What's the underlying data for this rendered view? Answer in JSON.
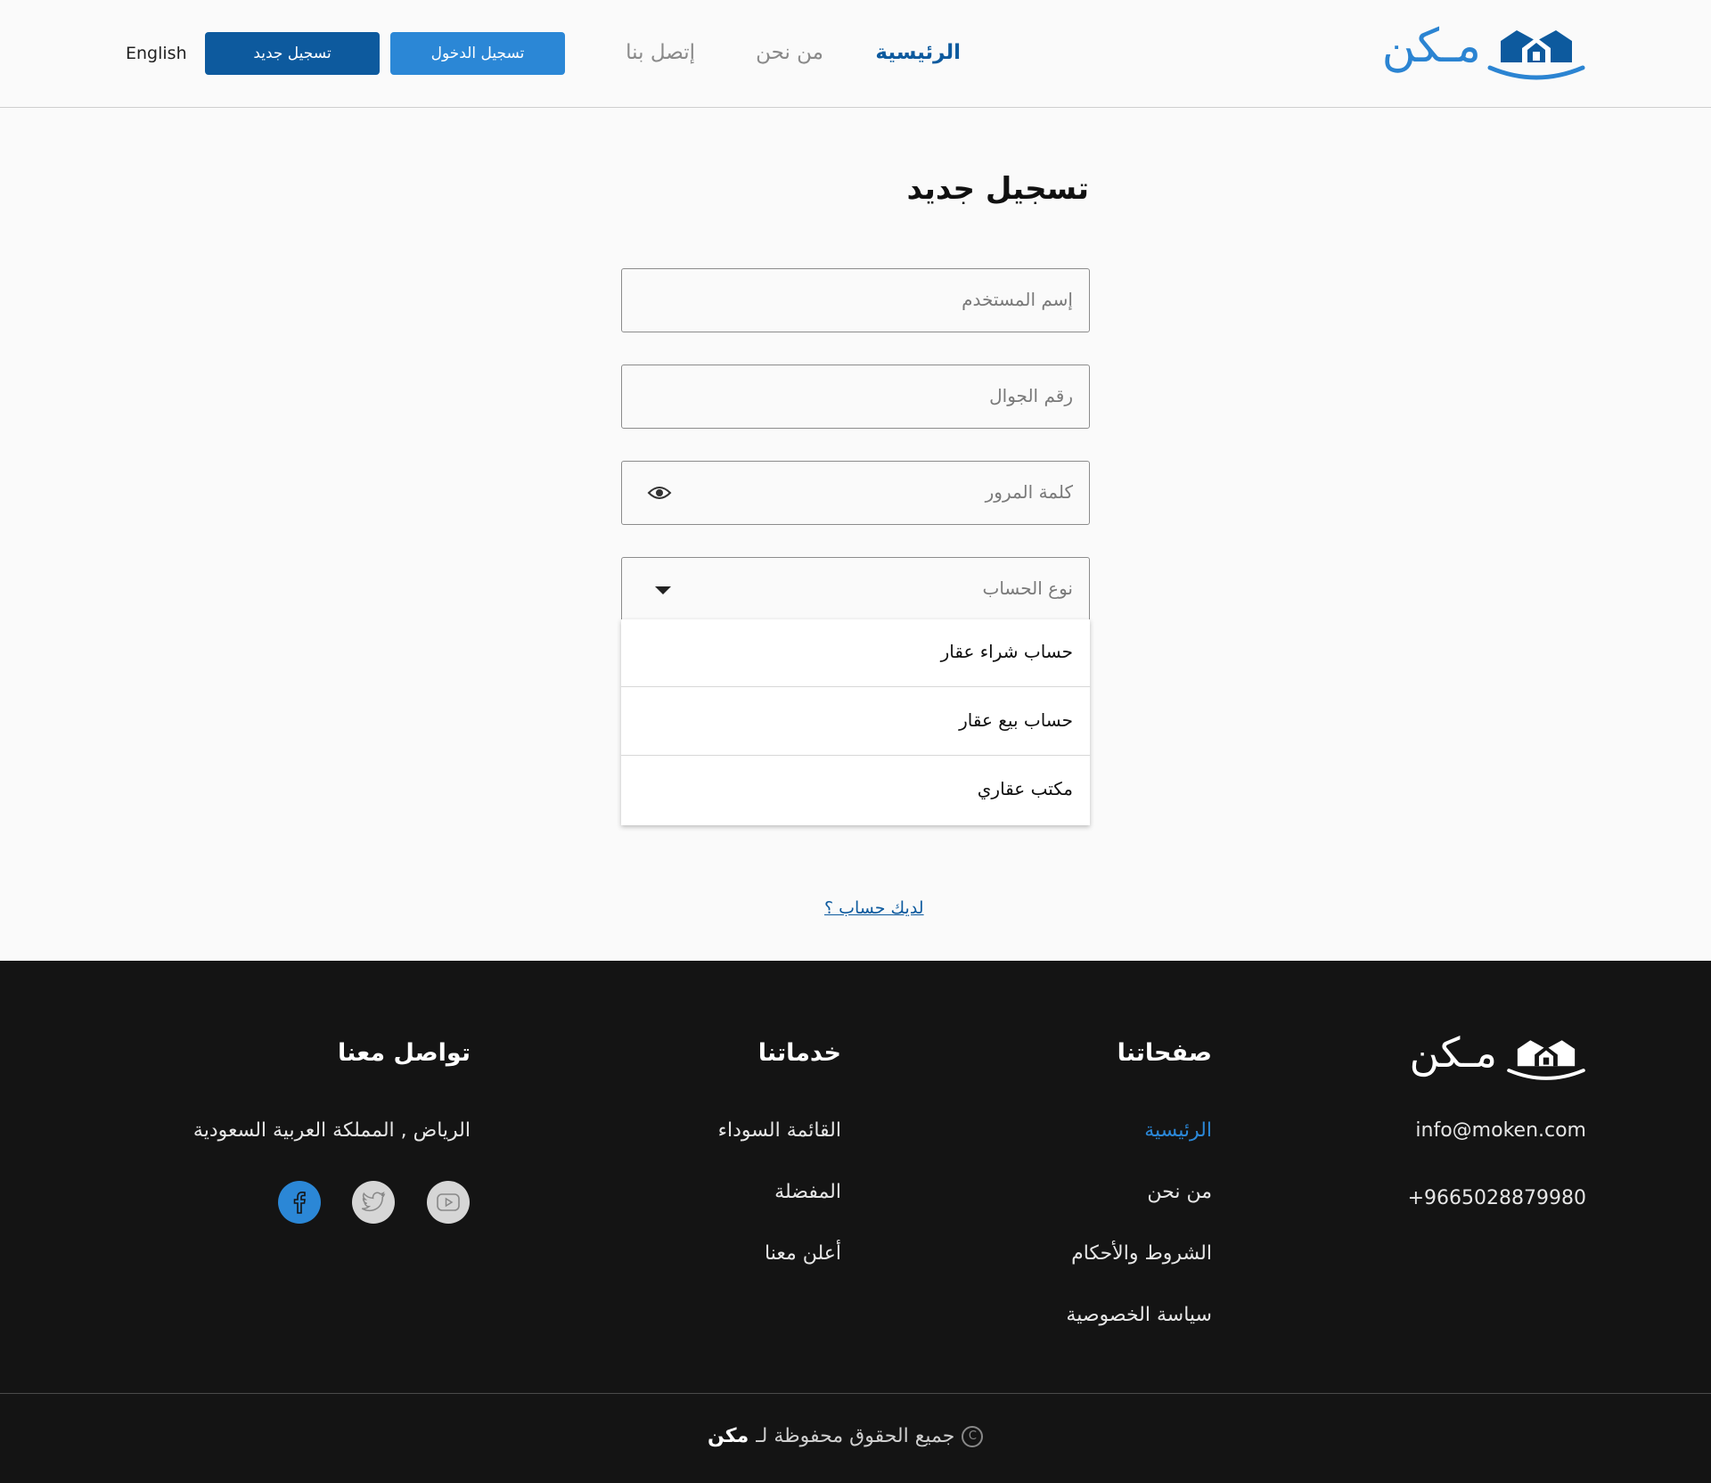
{
  "header": {
    "logo_text": "مـكن",
    "nav": {
      "home": "الرئيسية",
      "about": "من نحن",
      "contact": "إتصل بنا"
    },
    "login_label": "تسجيل الدخول",
    "register_label": "تسجيل جديد",
    "language_label": "English"
  },
  "form": {
    "title": "تسجيل جديد",
    "username_placeholder": "إسم المستخدم",
    "phone_placeholder": "رقم الجوال",
    "password_placeholder": "كلمة المرور",
    "account_type_placeholder": "نوع الحساب",
    "account_type_options": [
      "حساب شراء عقار",
      "حساب بيع عقار",
      "مكتب عقاري"
    ],
    "have_account_link": "لديك حساب ؟"
  },
  "footer": {
    "logo_text": "مـكن",
    "email": "info@moken.com",
    "phone": "+9665028879980",
    "pages": {
      "heading": "صفحاتنا",
      "links": [
        "الرئيسية",
        "من نحن",
        "الشروط والأحكام",
        "سياسة الخصوصية"
      ]
    },
    "services": {
      "heading": "خدماتنا",
      "links": [
        "القائمة السوداء",
        "المفضلة",
        "أعلن معنا"
      ]
    },
    "contact": {
      "heading": "تواصل معنا",
      "address": "الرياض , المملكة العربية السعودية",
      "social": [
        "facebook-icon",
        "twitter-icon",
        "youtube-icon"
      ]
    },
    "copyright_text": "جميع الحقوق محفوظة لـ",
    "copyright_brand": "مكن"
  },
  "colors": {
    "brand_dark": "#0d5a9e",
    "brand_light": "#2b87d6",
    "footer_bg": "#141414"
  }
}
